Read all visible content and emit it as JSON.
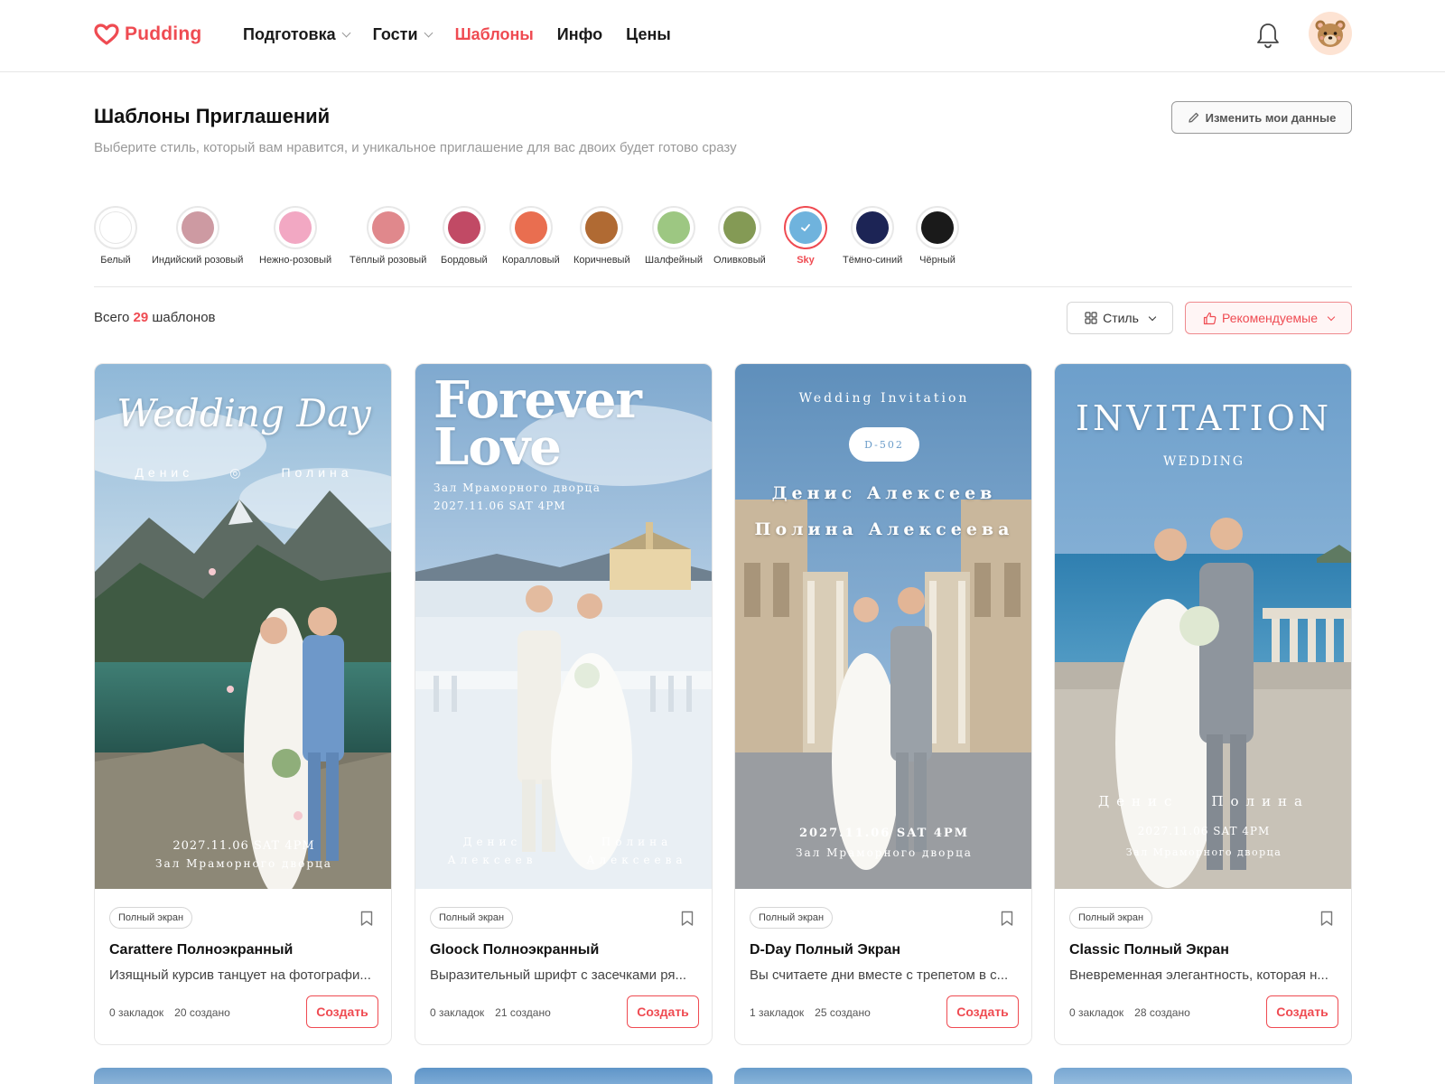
{
  "header": {
    "logo_text": "Pudding",
    "nav": [
      {
        "label": "Подготовка",
        "has_dropdown": true
      },
      {
        "label": "Гости",
        "has_dropdown": true
      },
      {
        "label": "Шаблоны",
        "active": true
      },
      {
        "label": "Инфо"
      },
      {
        "label": "Цены"
      }
    ],
    "icons": [
      "heart-logo-icon",
      "bell-icon",
      "bear-avatar-icon"
    ]
  },
  "page": {
    "title": "Шаблоны Приглашений",
    "subtitle": "Выберите стиль, который вам нравится, и уникальное приглашение для вас двоих будет готово сразу",
    "edit_button": "Изменить мои данные"
  },
  "colors": [
    {
      "label": "Белый",
      "hex": "#ffffff"
    },
    {
      "label": "Индийский розовый",
      "hex": "#cd9aa2"
    },
    {
      "label": "Нежно-розовый",
      "hex": "#f2a8c3"
    },
    {
      "label": "Тёплый розовый",
      "hex": "#e0888c"
    },
    {
      "label": "Бордовый",
      "hex": "#c14a65"
    },
    {
      "label": "Коралловый",
      "hex": "#e96e50"
    },
    {
      "label": "Коричневый",
      "hex": "#b06a33"
    },
    {
      "label": "Шалфейный",
      "hex": "#9dc782"
    },
    {
      "label": "Оливковый",
      "hex": "#849a55"
    },
    {
      "label": "Sky",
      "hex": "#6fb3dd",
      "selected": true
    },
    {
      "label": "Тёмно-синий",
      "hex": "#1c2455"
    },
    {
      "label": "Чёрный",
      "hex": "#1a1a1a"
    }
  ],
  "listing": {
    "count_prefix": "Всего",
    "count": "29",
    "count_suffix": "шаблонов",
    "style_filter": "Стиль",
    "sort": "Рекомендуемые"
  },
  "accent": "#ef4b52",
  "cards": [
    {
      "tag": "Полный экран",
      "title": "Carattere Полноэкранный",
      "desc": "Изящный курсив танцует на фотографи...",
      "bookmarks": "0 закладок",
      "created": "20 создано",
      "button": "Создать",
      "ov": {
        "headline": "Wedding Day",
        "groom": "Денис",
        "bride": "Полина",
        "date": "2027.11.06 SAT 4PM",
        "venue": "Зал Мраморного дворца"
      }
    },
    {
      "tag": "Полный экран",
      "title": "Gloock Полноэкранный",
      "desc": "Выразительный шрифт с засечками ря...",
      "bookmarks": "0 закладок",
      "created": "21 создано",
      "button": "Создать",
      "ov": {
        "line1": "Forever",
        "line2": "Love",
        "venue": "Зал Мраморного дворца",
        "date": "2027.11.06 SAT 4PM",
        "groom_first": "Денис",
        "groom_last": "Алексеев",
        "bride_first": "Полина",
        "bride_last": "Алексеева"
      }
    },
    {
      "tag": "Полный экран",
      "title": "D-Day Полный Экран",
      "desc": "Вы считаете дни вместе с трепетом в с...",
      "bookmarks": "1 закладок",
      "created": "25 создано",
      "button": "Создать",
      "ov": {
        "headline": "Wedding Invitation",
        "dday": "D-502",
        "groom": "Денис Алексеев",
        "bride": "Полина Алексеева",
        "date": "2027.11.06 SAT 4PM",
        "venue": "Зал Мраморного дворца"
      }
    },
    {
      "tag": "Полный экран",
      "title": "Classic Полный Экран",
      "desc": "Вневременная элегантность, которая н...",
      "bookmarks": "0 закладок",
      "created": "28 создано",
      "button": "Создать",
      "ov": {
        "headline": "INVITATION",
        "sub": "WEDDING",
        "groom": "Денис",
        "bride": "Полина",
        "date": "2027.11.06 SAT 4PM",
        "venue": "Зал Мраморного дворца"
      }
    }
  ]
}
